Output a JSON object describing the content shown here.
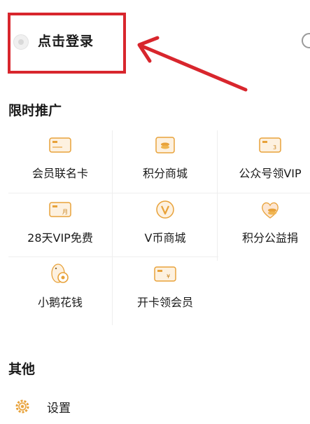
{
  "login": {
    "label": "点击登录"
  },
  "promo": {
    "title": "限时推广",
    "items": [
      {
        "label": "会员联名卡",
        "icon": "member-card-icon"
      },
      {
        "label": "积分商城",
        "icon": "points-mall-icon"
      },
      {
        "label": "公众号领VIP",
        "icon": "official-account-vip-icon"
      },
      {
        "label": "28天VIP免费",
        "icon": "free-vip-card-icon"
      },
      {
        "label": "V币商城",
        "icon": "vcoin-mall-icon"
      },
      {
        "label": "积分公益捐",
        "icon": "charity-donation-icon"
      },
      {
        "label": "小鹅花钱",
        "icon": "little-goose-money-icon"
      },
      {
        "label": "开卡领会员",
        "icon": "open-card-member-icon"
      }
    ]
  },
  "other": {
    "title": "其他",
    "settings_label": "设置"
  },
  "colors": {
    "accent": "#e8a23a",
    "highlight": "#d8262d"
  }
}
